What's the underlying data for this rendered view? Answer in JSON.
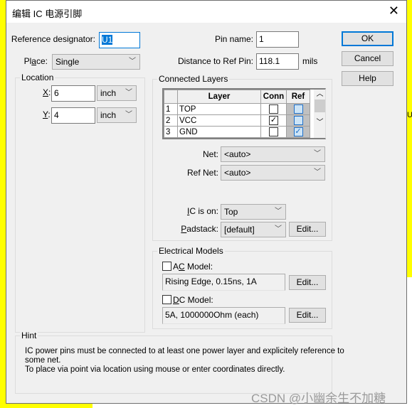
{
  "dialog": {
    "title": "编辑 IC 电源引脚",
    "close_icon": "close-icon"
  },
  "reference": {
    "label": "Reference designator:",
    "value": "U1"
  },
  "place": {
    "label_pre": "Pl",
    "label_u": "a",
    "label_post": "ce:",
    "value": "Single"
  },
  "location": {
    "title": "Location",
    "x_label": "X",
    "x_value": "6",
    "x_unit": "inch",
    "y_label": "Y",
    "y_value": "4",
    "y_unit": "inch"
  },
  "pin": {
    "name_label": "Pin name:",
    "name_value": "1",
    "distance_label": "Distance to Ref Pin:",
    "distance_value": "118.1",
    "distance_unit": "mils"
  },
  "buttons": {
    "ok": "OK",
    "cancel": "Cancel",
    "help": "Help"
  },
  "connected_layers": {
    "title": "Connected Layers",
    "columns": [
      "",
      "Layer",
      "Conn",
      "Ref"
    ],
    "rows": [
      {
        "num": "1",
        "layer": "TOP",
        "conn": false,
        "ref": false
      },
      {
        "num": "2",
        "layer": "VCC",
        "conn": true,
        "ref": false
      },
      {
        "num": "3",
        "layer": "GND",
        "conn": false,
        "ref": true
      }
    ],
    "net_label": "Net:",
    "net_value": "<auto>",
    "refnet_label": "Ref Net:",
    "refnet_value": "<auto>",
    "icon_label_u": "I",
    "icon_label_rest": "C is on:",
    "icon_value": "Top",
    "padstack_label_u": "P",
    "padstack_label_rest": "adstack:",
    "padstack_value": "[default]",
    "padstack_edit": "Edit..."
  },
  "electrical": {
    "title": "Electrical Models",
    "ac_pre": "A",
    "ac_u": "C",
    "ac_post": " Model:",
    "ac_checked": false,
    "ac_value": "Rising Edge, 0.15ns, 1A",
    "ac_edit": "Edit...",
    "dc_u": "D",
    "dc_post": "C Model:",
    "dc_checked": false,
    "dc_value": "5A, 1000000Ohm (each)",
    "dc_edit": "Edit..."
  },
  "hint": {
    "title": "Hint",
    "line1": "IC power pins must be connected to at least one power layer and explicitely reference to",
    "line2": "some net.",
    "line3": "To place via point via location using mouse or enter coordinates directly."
  },
  "watermark": "CSDN @小幽余生不加糖",
  "background_fragment": "U",
  "colors": {
    "accent": "#0078d7",
    "background": "#ffff00",
    "selection": "#0078d7"
  }
}
